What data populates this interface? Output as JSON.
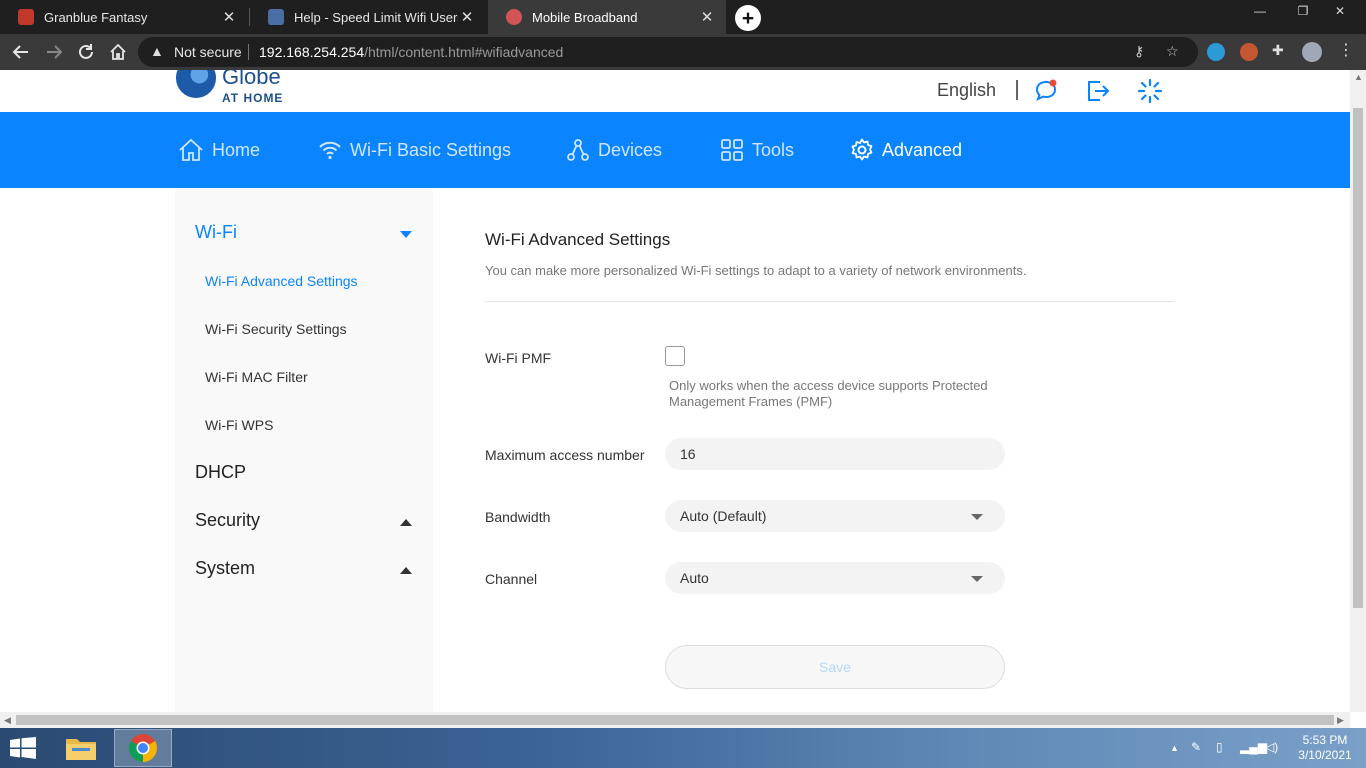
{
  "browser": {
    "tabs": [
      {
        "label": "Granblue Fantasy",
        "favicon_color": "#c0392b"
      },
      {
        "label": "Help - Speed Limit Wifi Users in G",
        "favicon_color": "#4a6fa5"
      },
      {
        "label": "Mobile Broadband",
        "favicon_color": "#d35454"
      }
    ],
    "new_tab": "+",
    "window_controls": {
      "minimize": "—",
      "restore": "❐",
      "close": "✕"
    },
    "address": {
      "security_label": "Not secure",
      "host": "192.168.254.254",
      "path": "/html/content.html#wifiadvanced"
    }
  },
  "header": {
    "logo_text": "Globe",
    "logo_sub": "AT HOME",
    "language": "English"
  },
  "mainnav": {
    "items": [
      {
        "label": "Home",
        "icon": "home-icon"
      },
      {
        "label": "Wi-Fi Basic Settings",
        "icon": "wifi-icon"
      },
      {
        "label": "Devices",
        "icon": "devices-icon"
      },
      {
        "label": "Tools",
        "icon": "tools-icon"
      },
      {
        "label": "Advanced",
        "icon": "gear-icon"
      }
    ],
    "active": "Advanced"
  },
  "sidebar": {
    "groups": [
      {
        "label": "Wi-Fi",
        "expanded": true,
        "items": [
          "Wi-Fi Advanced Settings",
          "Wi-Fi Security Settings",
          "Wi-Fi MAC Filter",
          "Wi-Fi WPS"
        ]
      },
      {
        "label": "DHCP"
      },
      {
        "label": "Security"
      },
      {
        "label": "System"
      }
    ],
    "active_item": "Wi-Fi Advanced Settings"
  },
  "content": {
    "title": "Wi-Fi Advanced Settings",
    "description": "You can make more personalized Wi-Fi settings to adapt to a variety of network environments.",
    "pmf": {
      "label": "Wi-Fi PMF",
      "checked": false,
      "hint": "Only works when the access device supports Protected Management Frames (PMF)"
    },
    "max_access": {
      "label": "Maximum access number",
      "value": "16"
    },
    "bandwidth": {
      "label": "Bandwidth",
      "value": "Auto (Default)"
    },
    "channel": {
      "label": "Channel",
      "value": "Auto"
    },
    "save_label": "Save"
  },
  "taskbar": {
    "time": "5:53 PM",
    "date": "3/10/2021"
  },
  "colors": {
    "brand_blue": "#0a84ff",
    "logo_blue": "#1d4f91"
  }
}
